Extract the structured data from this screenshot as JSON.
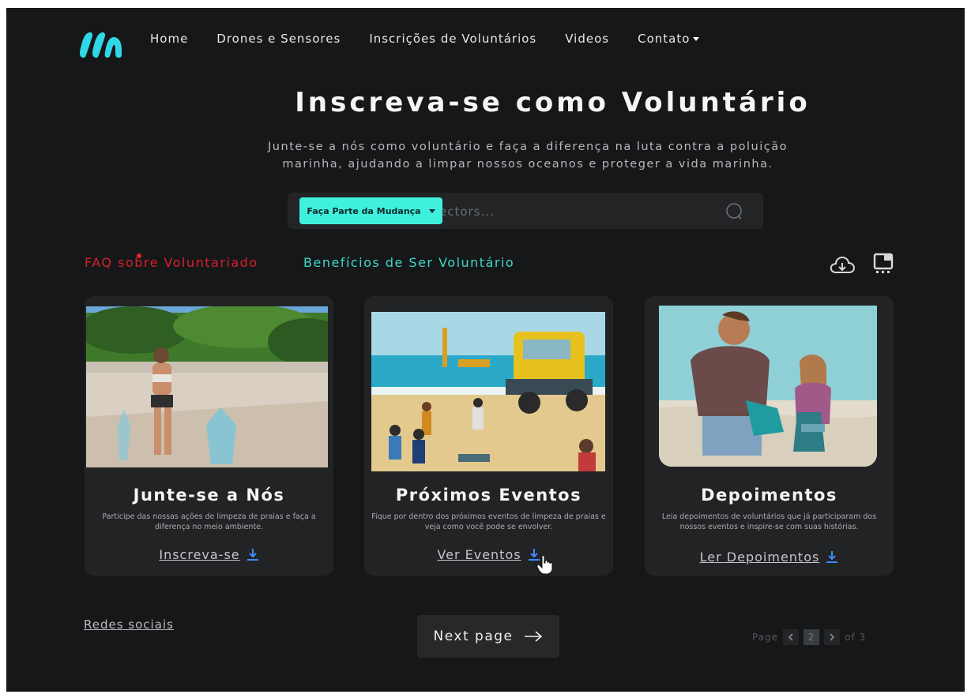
{
  "nav": {
    "items": [
      "Home",
      "Drones e Sensores",
      "Inscrições de Voluntários",
      "Videos",
      "Contato"
    ]
  },
  "hero": {
    "title": "Inscreva-se como Voluntário",
    "subtitle": "Junte-se a nós como voluntário e faça a diferença na luta contra a poluição marinha, ajudando a limpar nossos oceanos e proteger a vida marinha."
  },
  "search": {
    "button_label": "Faça Parte da Mudança",
    "placeholder": "ectors..."
  },
  "tabs": {
    "faq": "FAQ sobre Voluntariado",
    "benefits": "Benefícios de Ser Voluntário"
  },
  "cards": [
    {
      "title": "Junte-se a Nós",
      "desc": "Participe das nossas ações de limpeza de praias e faça a diferença no meio ambiente.",
      "link": "Inscreva-se"
    },
    {
      "title": "Próximos Eventos",
      "desc": "Fique por dentro dos próximos eventos de limpeza de praias e veja como você pode se envolver.",
      "link": "Ver Eventos"
    },
    {
      "title": "Depoimentos",
      "desc": "Leia depoimentos de voluntários que já participaram dos nossos eventos e inspire-se com suas histórias.",
      "link": "Ler Depoimentos"
    }
  ],
  "footer": {
    "social": "Redes sociais",
    "next_label": "Next page",
    "pager": {
      "prefix": "Page",
      "current": "2",
      "suffix": "of 3"
    }
  },
  "colors": {
    "accent": "#3ff0dd",
    "link_icon": "#3d8bff",
    "faq_red": "#d6202b",
    "background": "#161718"
  }
}
